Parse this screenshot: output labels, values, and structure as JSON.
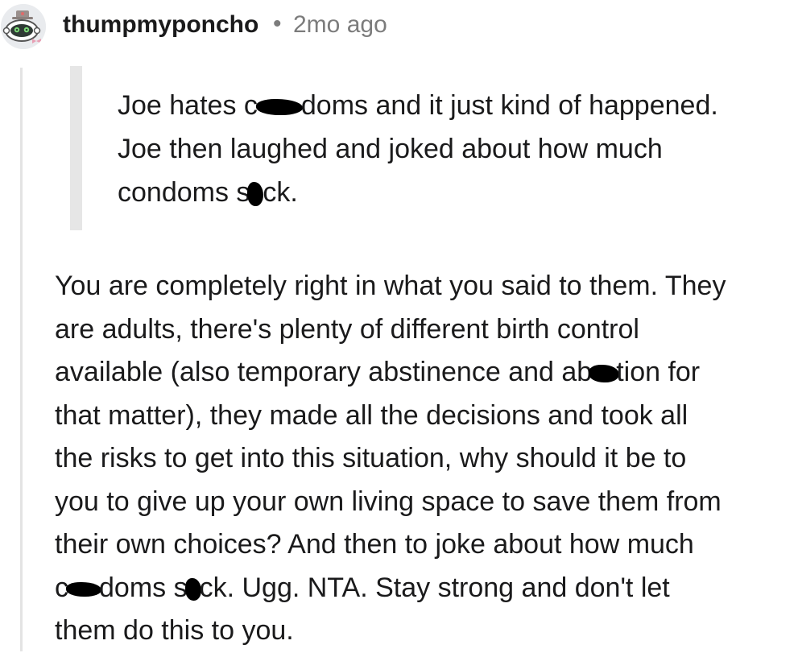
{
  "comment": {
    "author": "thumpmyponcho",
    "separator": "•",
    "time_ago": "2mo ago",
    "quote_lines": [
      [
        "Joe hates c",
        "doms and it just kind of happened."
      ],
      [
        "Joe then laughed and joked about how much"
      ],
      [
        "condoms s",
        "ck."
      ]
    ],
    "body_lines": [
      [
        "You are completely right in what you said to them. They"
      ],
      [
        "are adults, there's plenty of different birth control"
      ],
      [
        "available (also temporary abstinence and ab",
        "tion for"
      ],
      [
        "that matter), they made all the decisions and took all"
      ],
      [
        "the risks to get into this situation, why should it be to"
      ],
      [
        "you to give up your own living space to save them from"
      ],
      [
        "their own choices? And then to joke about how much"
      ],
      [
        "c",
        "doms s",
        "ck. Ugg. NTA. Stay strong and don't let"
      ],
      [
        "them do this to you."
      ]
    ]
  },
  "colors": {
    "text": "#1a1a1b",
    "muted": "#7c7c7c",
    "thread_line": "#e3e3e3",
    "quote_bar": "#e6e6e6",
    "redaction": "#000000"
  },
  "icons": {
    "avatar": "snoo-robot-avatar-icon"
  }
}
